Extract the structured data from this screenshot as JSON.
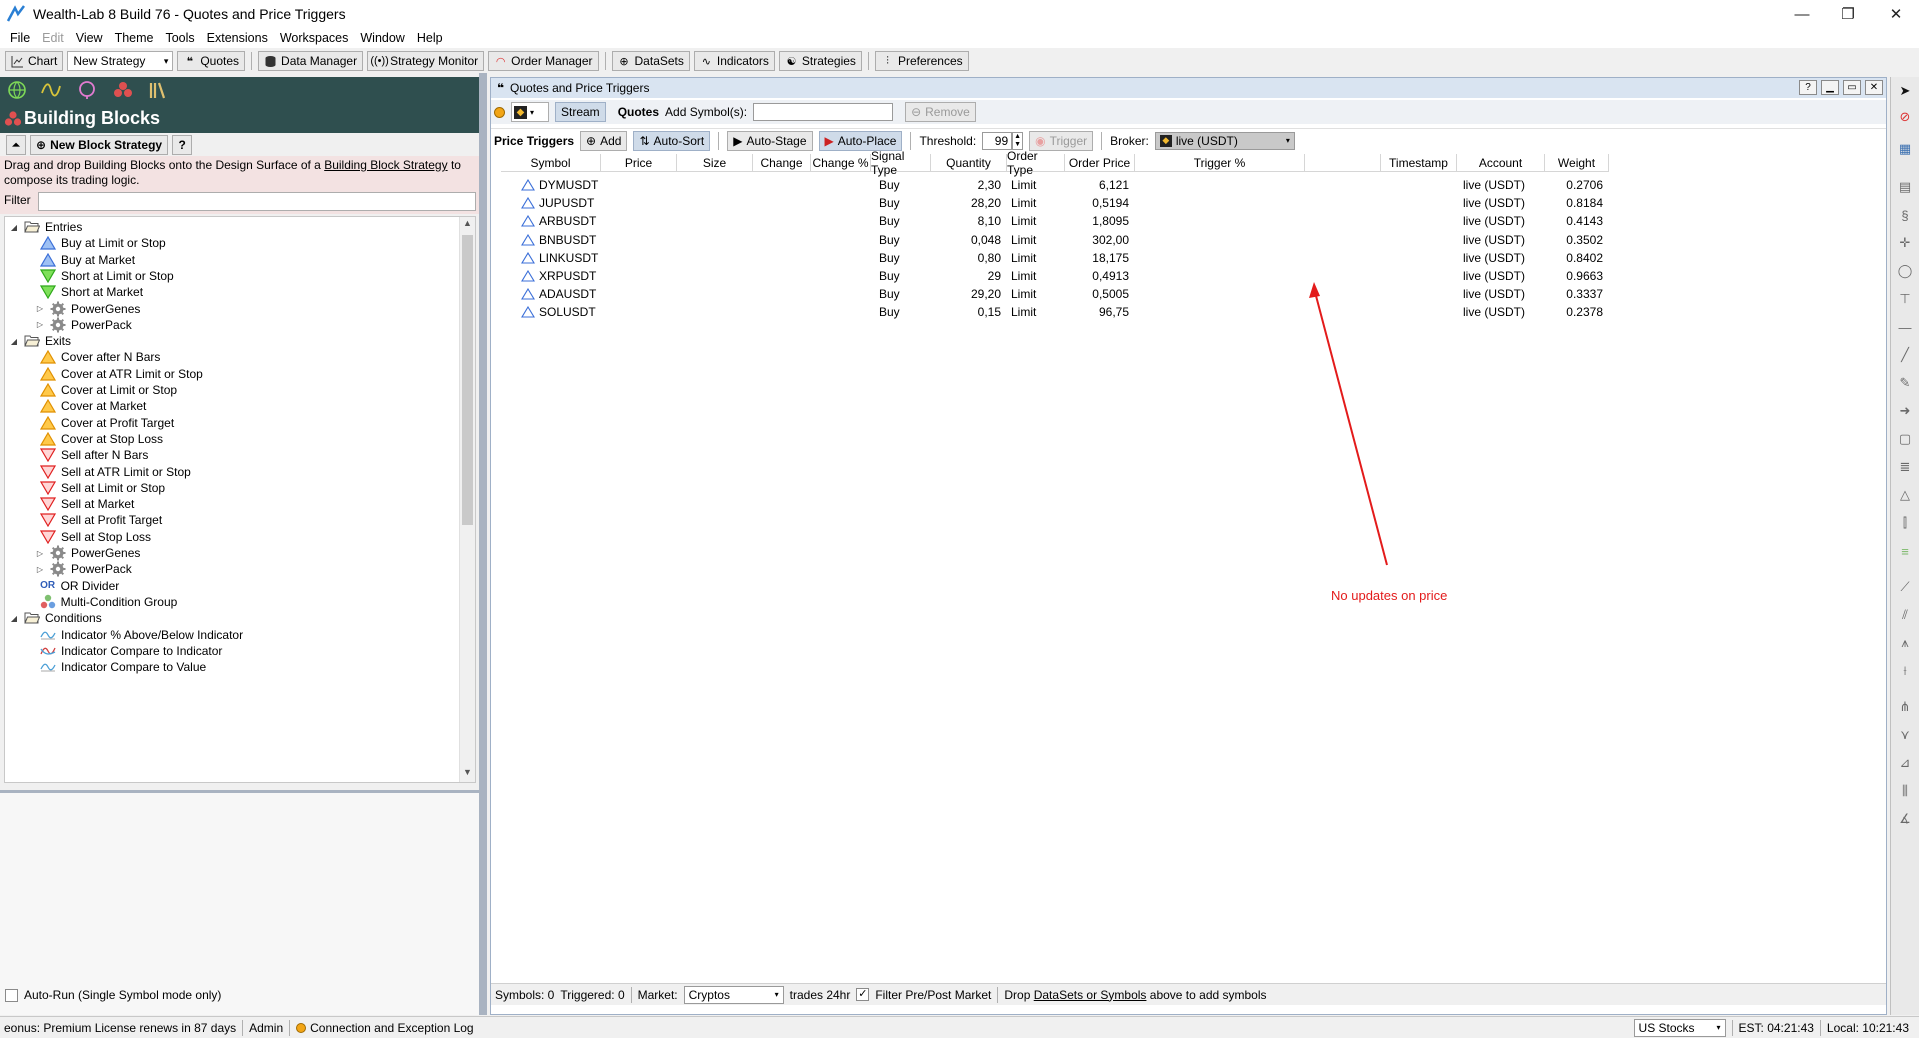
{
  "window": {
    "title": "Wealth-Lab 8 Build 76 - Quotes and Price Triggers",
    "minimize": "—",
    "restore": "❐",
    "close": "✕"
  },
  "menu": [
    "File",
    "Edit",
    "View",
    "Theme",
    "Tools",
    "Extensions",
    "Workspaces",
    "Window",
    "Help"
  ],
  "toolbar": {
    "chart": "Chart",
    "new_strategy": "New Strategy",
    "quotes": "Quotes",
    "data_manager": "Data Manager",
    "strategy_monitor": "Strategy Monitor",
    "order_manager": "Order Manager",
    "datasets": "DataSets",
    "indicators": "Indicators",
    "strategies": "Strategies",
    "preferences": "Preferences"
  },
  "building_blocks": {
    "title": "Building Blocks",
    "new_block_strategy": "New Block Strategy",
    "help": "?",
    "description_part1": "Drag and drop Building Blocks onto the Design Surface of a ",
    "description_link": "Building Block Strategy",
    "description_part2": " to compose its trading logic.",
    "filter_label": "Filter",
    "filter_value": "",
    "tree": [
      {
        "label": "Entries",
        "level": 0,
        "icon": "folder-open-icon",
        "exp": "◢"
      },
      {
        "label": "Buy at Limit or Stop",
        "level": 1,
        "icon": "buy-triangle-icon"
      },
      {
        "label": "Buy at Market",
        "level": 1,
        "icon": "buy-triangle-icon"
      },
      {
        "label": "Short at Limit or Stop",
        "level": 1,
        "icon": "short-triangle-icon"
      },
      {
        "label": "Short at Market",
        "level": 1,
        "icon": "short-triangle-icon"
      },
      {
        "label": "PowerGenes",
        "level": 1,
        "icon": "gear-icon",
        "exp": "▷"
      },
      {
        "label": "PowerPack",
        "level": 1,
        "icon": "gear-icon",
        "exp": "▷"
      },
      {
        "label": "Exits",
        "level": 0,
        "icon": "folder-open-icon",
        "exp": "◢"
      },
      {
        "label": "Cover after N Bars",
        "level": 1,
        "icon": "cover-triangle-icon"
      },
      {
        "label": "Cover at ATR Limit or Stop",
        "level": 1,
        "icon": "cover-triangle-icon"
      },
      {
        "label": "Cover at Limit or Stop",
        "level": 1,
        "icon": "cover-triangle-icon"
      },
      {
        "label": "Cover at Market",
        "level": 1,
        "icon": "cover-triangle-icon"
      },
      {
        "label": "Cover at Profit Target",
        "level": 1,
        "icon": "cover-triangle-icon"
      },
      {
        "label": "Cover at Stop Loss",
        "level": 1,
        "icon": "cover-triangle-icon"
      },
      {
        "label": "Sell after N Bars",
        "level": 1,
        "icon": "sell-triangle-icon"
      },
      {
        "label": "Sell at ATR Limit or Stop",
        "level": 1,
        "icon": "sell-triangle-icon"
      },
      {
        "label": "Sell at Limit or Stop",
        "level": 1,
        "icon": "sell-triangle-icon"
      },
      {
        "label": "Sell at Market",
        "level": 1,
        "icon": "sell-triangle-icon"
      },
      {
        "label": "Sell at Profit Target",
        "level": 1,
        "icon": "sell-triangle-icon"
      },
      {
        "label": "Sell at Stop Loss",
        "level": 1,
        "icon": "sell-triangle-icon"
      },
      {
        "label": "PowerGenes",
        "level": 1,
        "icon": "gear-icon",
        "exp": "▷"
      },
      {
        "label": "PowerPack",
        "level": 1,
        "icon": "gear-icon",
        "exp": "▷"
      },
      {
        "label": "OR Divider",
        "level": 0.6,
        "icon": "or-icon",
        "icon_text": "OR"
      },
      {
        "label": "Multi-Condition Group",
        "level": 0.6,
        "icon": "group-icon"
      },
      {
        "label": "Conditions",
        "level": 0,
        "icon": "folder-open-icon",
        "exp": "◢"
      },
      {
        "label": "Indicator % Above/Below Indicator",
        "level": 1,
        "icon": "indicator-icon"
      },
      {
        "label": "Indicator Compare to Indicator",
        "level": 1,
        "icon": "indicator-compare-icon"
      },
      {
        "label": "Indicator Compare to Value",
        "level": 1,
        "icon": "indicator-icon"
      }
    ],
    "auto_run": "Auto-Run (Single Symbol mode only)"
  },
  "quotes_panel": {
    "title": "Quotes and Price Triggers",
    "help": "?",
    "stream": "Stream",
    "quotes_label": "Quotes",
    "add_symbols_label": "Add Symbol(s):",
    "add_symbols_value": "",
    "remove": "Remove",
    "price_triggers_label": "Price Triggers",
    "add": "Add",
    "auto_sort": "Auto-Sort",
    "auto_stage": "Auto-Stage",
    "auto_place": "Auto-Place",
    "threshold_label": "Threshold:",
    "threshold_value": "99",
    "trigger": "Trigger",
    "broker_label": "Broker:",
    "broker_value": "live (USDT)",
    "columns": [
      "Symbol",
      "Price",
      "Size",
      "Change",
      "Change %",
      "Signal Type",
      "Quantity",
      "Order Type",
      "Order Price",
      "Trigger %",
      "",
      "Timestamp",
      "Account",
      "Weight"
    ],
    "rows": [
      {
        "symbol": "DYMUSDT",
        "signal": "Buy",
        "quantity": "2,30",
        "order_type": "Limit",
        "order_price": "6,121",
        "account": "live (USDT)",
        "weight": "0.2706"
      },
      {
        "symbol": "JUPUSDT",
        "signal": "Buy",
        "quantity": "28,20",
        "order_type": "Limit",
        "order_price": "0,5194",
        "account": "live (USDT)",
        "weight": "0.8184"
      },
      {
        "symbol": "ARBUSDT",
        "signal": "Buy",
        "quantity": "8,10",
        "order_type": "Limit",
        "order_price": "1,8095",
        "account": "live (USDT)",
        "weight": "0.4143"
      },
      {
        "symbol": "BNBUSDT",
        "signal": "Buy",
        "quantity": "0,048",
        "order_type": "Limit",
        "order_price": "302,00",
        "account": "live (USDT)",
        "weight": "0.3502"
      },
      {
        "symbol": "LINKUSDT",
        "signal": "Buy",
        "quantity": "0,80",
        "order_type": "Limit",
        "order_price": "18,175",
        "account": "live (USDT)",
        "weight": "0.8402"
      },
      {
        "symbol": "XRPUSDT",
        "signal": "Buy",
        "quantity": "29",
        "order_type": "Limit",
        "order_price": "0,4913",
        "account": "live (USDT)",
        "weight": "0.9663"
      },
      {
        "symbol": "ADAUSDT",
        "signal": "Buy",
        "quantity": "29,20",
        "order_type": "Limit",
        "order_price": "0,5005",
        "account": "live (USDT)",
        "weight": "0.3337"
      },
      {
        "symbol": "SOLUSDT",
        "signal": "Buy",
        "quantity": "0,15",
        "order_type": "Limit",
        "order_price": "96,75",
        "account": "live (USDT)",
        "weight": "0.2378"
      }
    ],
    "status": {
      "symbols": "Symbols: 0",
      "triggered": "Triggered: 0",
      "market_label": "Market:",
      "market_value": "Cryptos",
      "trades": "trades 24hr",
      "filter": "Filter Pre/Post Market",
      "drop_part1": "Drop ",
      "drop_link": "DataSets or Symbols",
      "drop_part2": " above to add symbols"
    }
  },
  "annotation": {
    "text": "No updates on price",
    "color": "#e31b1b"
  },
  "statusbar": {
    "license": "eonus: Premium License renews in 87 days",
    "admin": "Admin",
    "log": "Connection and Exception Log",
    "market": "US Stocks",
    "est": "EST: 04:21:43",
    "local": "Local: 10:21:43"
  },
  "colors": {
    "panel_dark": "#2f4f4f",
    "buy": "#3b6fd8",
    "short": "#3cc828",
    "cover": "#f0a000",
    "sell": "#e02020"
  }
}
